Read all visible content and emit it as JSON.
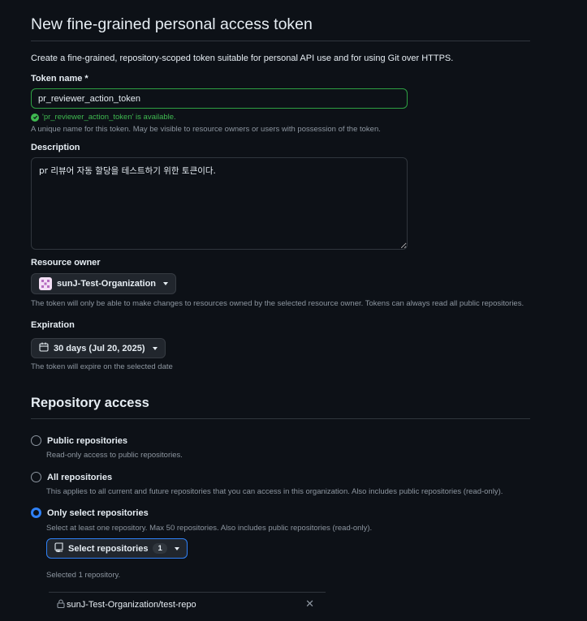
{
  "page": {
    "title": "New fine-grained personal access token",
    "intro": "Create a fine-grained, repository-scoped token suitable for personal API use and for using Git over HTTPS."
  },
  "token_name": {
    "label": "Token name *",
    "value": "pr_reviewer_action_token",
    "valid_message": "'pr_reviewer_action_token' is available.",
    "note": "A unique name for this token. May be visible to resource owners or users with possession of the token."
  },
  "description": {
    "label": "Description",
    "value": "pr 리뷰어 자동 할당을 테스트하기 위한 토큰이다."
  },
  "resource_owner": {
    "label": "Resource owner",
    "selected": "sunJ-Test-Organization",
    "note": "The token will only be able to make changes to resources owned by the selected resource owner. Tokens can always read all public repositories."
  },
  "expiration": {
    "label": "Expiration",
    "selected": "30 days (Jul 20, 2025)",
    "note": "The token will expire on the selected date"
  },
  "repository_access": {
    "title": "Repository access",
    "options": [
      {
        "label": "Public repositories",
        "note": "Read-only access to public repositories.",
        "checked": false
      },
      {
        "label": "All repositories",
        "note": "This applies to all current and future repositories that you can access in this organization. Also includes public repositories (read-only).",
        "checked": false
      },
      {
        "label": "Only select repositories",
        "note": "Select at least one repository. Max 50 repositories. Also includes public repositories (read-only).",
        "checked": true
      }
    ],
    "select_button_label": "Select repositories",
    "select_count": "1",
    "selected_summary": "Selected 1 repository.",
    "selected_repos": [
      "sunJ-Test-Organization/test-repo"
    ]
  },
  "colors": {
    "background": "#0d1117",
    "success": "#3fb950",
    "accent": "#2f81f7",
    "muted_text": "#8d96a0",
    "border": "#30363d"
  },
  "icons": {
    "valid": "check-circle-fill-icon",
    "calendar": "calendar-icon",
    "repo": "repo-icon",
    "lock": "lock-icon",
    "remove": "x-icon",
    "dropdown": "triangle-down-icon"
  }
}
